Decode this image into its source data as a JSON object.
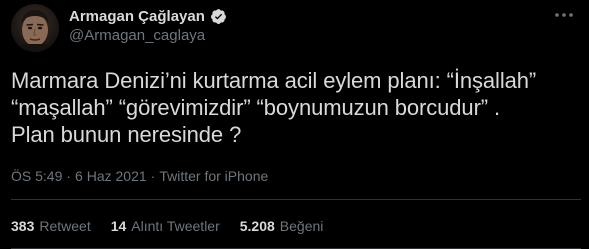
{
  "author": {
    "display_name": "Armagan Çağlayan",
    "handle": "@Armagan_caglaya",
    "verified": true
  },
  "tweet": {
    "text": "Marmara Denizi’ni kurtarma acil eylem planı: “İnşallah”\n“maşallah” “görevimizdir” “boynumuzun borcudur” .\nPlan bunun neresinde ?"
  },
  "meta": {
    "time": "ÖS 5:49",
    "separator": "·",
    "date": "6 Haz 2021",
    "source": "Twitter for iPhone"
  },
  "stats": [
    {
      "count": "383",
      "label": "Retweet"
    },
    {
      "count": "14",
      "label": "Alıntı Tweetler"
    },
    {
      "count": "5.208",
      "label": "Beğeni"
    }
  ],
  "icons": {
    "verified": "verified-badge-icon",
    "more": "more-horizontal-icon"
  },
  "colors": {
    "background": "#000000",
    "text": "#d9d9d9",
    "secondary_text": "#6e767d",
    "verified": "#d9d9d9",
    "divider": "#2f3336"
  }
}
